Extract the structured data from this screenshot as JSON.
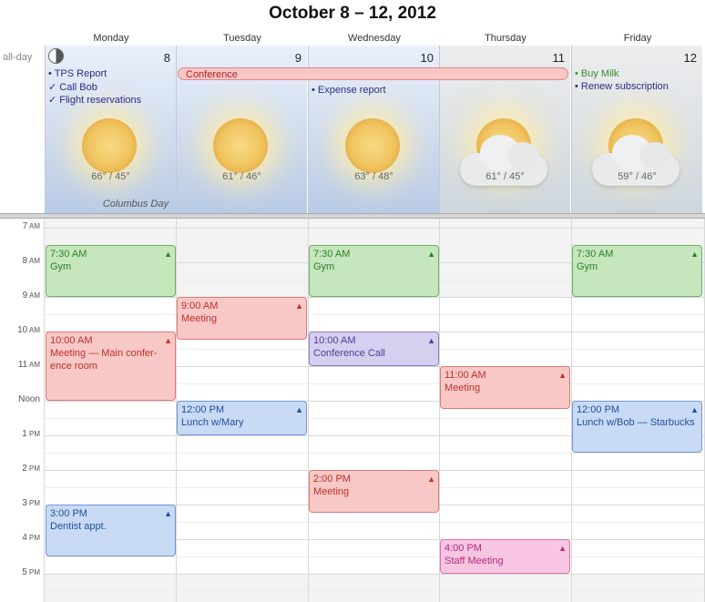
{
  "header": {
    "title": "October 8 – 12, 2012"
  },
  "allday_label": "all-day",
  "days": [
    {
      "name": "Monday",
      "number": "8",
      "weather": "sunny",
      "temp": "66° / 45°",
      "holiday": "Columbus Day",
      "todos": [
        {
          "text": "• TPS Report"
        },
        {
          "text": "✓ Call Bob"
        },
        {
          "text": "✓ Flight reservations"
        }
      ]
    },
    {
      "name": "Tuesday",
      "number": "9",
      "weather": "sunny",
      "temp": "61° / 46°",
      "todos": []
    },
    {
      "name": "Wednesday",
      "number": "10",
      "weather": "sunny",
      "temp": "63° / 48°",
      "todos": [
        {
          "text": "• Expense report"
        }
      ]
    },
    {
      "name": "Thursday",
      "number": "11",
      "weather": "cloudy",
      "temp": "61° / 45°",
      "todos": []
    },
    {
      "name": "Friday",
      "number": "12",
      "weather": "cloudy",
      "temp": "59° / 46°",
      "todos": [
        {
          "text": "• Buy Milk",
          "color": "#3a8a2e"
        },
        {
          "text": "• Renew subscription"
        }
      ]
    }
  ],
  "allday_event": {
    "title": "Conference"
  },
  "hours": [
    {
      "num": "7",
      "ampm": "AM"
    },
    {
      "num": "8",
      "ampm": "AM"
    },
    {
      "num": "9",
      "ampm": "AM"
    },
    {
      "num": "10",
      "ampm": "AM"
    },
    {
      "num": "11",
      "ampm": "AM"
    },
    {
      "num": "Noon",
      "ampm": ""
    },
    {
      "num": "1",
      "ampm": "PM"
    },
    {
      "num": "2",
      "ampm": "PM"
    },
    {
      "num": "3",
      "ampm": "PM"
    },
    {
      "num": "4",
      "ampm": "PM"
    },
    {
      "num": "5",
      "ampm": "PM"
    }
  ],
  "events": [
    {
      "day": 0,
      "start": 7.5,
      "end": 9.0,
      "time": "7:30 AM",
      "title": "Gym",
      "color": "green"
    },
    {
      "day": 2,
      "start": 7.5,
      "end": 9.0,
      "time": "7:30 AM",
      "title": "Gym",
      "color": "green"
    },
    {
      "day": 4,
      "start": 7.5,
      "end": 9.0,
      "time": "7:30 AM",
      "title": "Gym",
      "color": "green"
    },
    {
      "day": 1,
      "start": 9.0,
      "end": 10.25,
      "time": "9:00 AM",
      "title": "Meeting",
      "color": "red"
    },
    {
      "day": 0,
      "start": 10.0,
      "end": 12.0,
      "time": "10:00 AM",
      "title": "Meeting — Main confer-\nence room",
      "color": "red"
    },
    {
      "day": 2,
      "start": 10.0,
      "end": 11.0,
      "time": "10:00 AM",
      "title": "Conference Call",
      "color": "purple"
    },
    {
      "day": 3,
      "start": 11.0,
      "end": 12.25,
      "time": "11:00 AM",
      "title": "Meeting",
      "color": "red"
    },
    {
      "day": 1,
      "start": 12.0,
      "end": 13.0,
      "time": "12:00 PM",
      "title": "Lunch w/Mary",
      "color": "blue"
    },
    {
      "day": 4,
      "start": 12.0,
      "end": 13.5,
      "time": "12:00 PM",
      "title": "Lunch w/Bob — Starbucks",
      "color": "blue"
    },
    {
      "day": 2,
      "start": 14.0,
      "end": 15.25,
      "time": "2:00 PM",
      "title": "Meeting",
      "color": "red"
    },
    {
      "day": 0,
      "start": 15.0,
      "end": 16.5,
      "time": "3:00 PM",
      "title": "Dentist appt.",
      "color": "blue"
    },
    {
      "day": 3,
      "start": 16.0,
      "end": 17.0,
      "time": "4:00 PM",
      "title": "Staff Meeting",
      "color": "pink"
    }
  ],
  "colors": {
    "accent": "#d6d6d6",
    "todo": "#2a2a88"
  }
}
